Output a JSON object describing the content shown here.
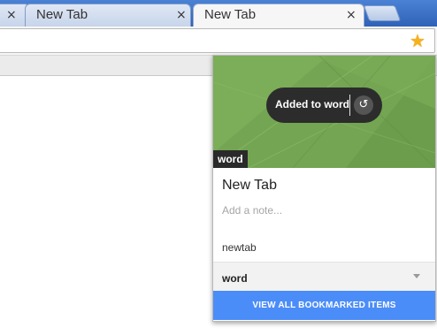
{
  "tabs": [
    {
      "label": "",
      "close": "×"
    },
    {
      "label": "New Tab",
      "close": "×"
    },
    {
      "label": "New Tab",
      "close": "×",
      "active": true
    }
  ],
  "toolbar": {
    "bookmark_icon": "star-icon",
    "bookmark_glyph": "★",
    "accent": "#f6b21a"
  },
  "bubble": {
    "toast_text": "Added to word",
    "undo_glyph": "↺",
    "folder_chip": "word",
    "title": "New Tab",
    "note_placeholder": "Add a note...",
    "tag": "newtab",
    "folder_select": "word",
    "view_all": "VIEW ALL BOOKMARKED ITEMS",
    "banner_color": "#74a552",
    "button_color": "#4b8df8"
  }
}
